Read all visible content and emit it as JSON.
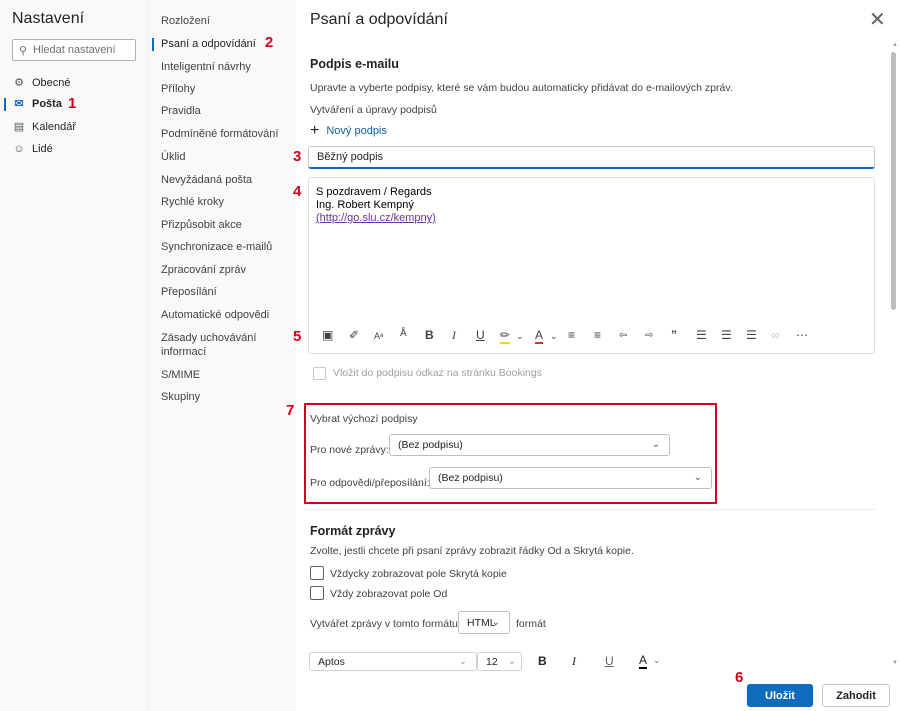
{
  "settings_title": "Nastavení",
  "search": {
    "placeholder": "Hledat nastavení"
  },
  "left_nav": [
    {
      "label": "Obecné",
      "icon": "gear-icon"
    },
    {
      "label": "Pošta",
      "icon": "mail-icon"
    },
    {
      "label": "Kalendář",
      "icon": "calendar-icon"
    },
    {
      "label": "Lidé",
      "icon": "people-icon"
    }
  ],
  "mid_nav": [
    "Rozložení",
    "Psaní a odpovídání",
    "Inteligentní návrhy",
    "Přílohy",
    "Pravidla",
    "Podmíněné formátování",
    "Úklid",
    "Nevyžádaná pošta",
    "Rychlé kroky",
    "Přizpůsobit akce",
    "Synchronizace e-mailů",
    "Zpracování zpráv",
    "Přeposílání",
    "Automatické odpovědi",
    "Zásady uchovávání informací",
    "S/MIME",
    "Skupiny"
  ],
  "annotations": [
    "1",
    "2",
    "3",
    "4",
    "5",
    "6",
    "7"
  ],
  "panel": {
    "title": "Psaní a odpovídání",
    "signature": {
      "heading": "Podpis e-mailu",
      "description": "Upravte a vyberte podpisy, které se vám budou automaticky přidávat do e-mailových zpráv.",
      "create_label": "Vytváření a úpravy podpisů",
      "new_signature": "Nový podpis",
      "name_value": "Běžný podpis",
      "body_line1": "S pozdravem / Regards",
      "body_line2": "Ing. Robert Kempný",
      "body_line3": "(http://go.slu.cz/kempny)",
      "bookings_label": "Vložit do podpisu odkaz na stránku Bookings"
    },
    "defaults": {
      "heading": "Vybrat výchozí podpisy",
      "new_label": "Pro nové zprávy:",
      "new_value": "(Bez podpisu)",
      "reply_label": "Pro odpovědi/přeposílání:",
      "reply_value": "(Bez podpisu)"
    },
    "format": {
      "heading": "Formát zprávy",
      "description": "Zvolte, jestli chcete při psaní zprávy zobrazit řádky Od a Skrytá kopie.",
      "bcc_label": "Vždycky zobrazovat pole Skrytá kopie",
      "from_label": "Vždy zobrazovat pole Od",
      "compose_label": "Vytvářet zprávy v tomto formátu:",
      "compose_value": "HTML",
      "compose_suffix": "formát",
      "font_value": "Aptos",
      "size_value": "12"
    },
    "buttons": {
      "save": "Uložit",
      "discard": "Zahodit"
    }
  },
  "colors": {
    "accent": "#0f6cbd",
    "annotation": "#d0021b",
    "primary_button": "#0f6cbd"
  }
}
